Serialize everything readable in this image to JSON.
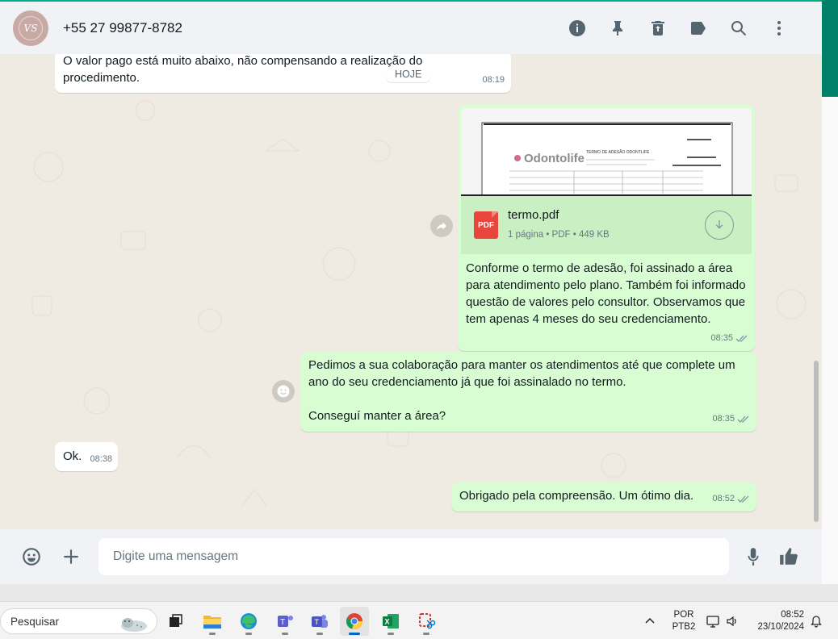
{
  "header": {
    "avatar_initials": "VS",
    "contact_name": "+55 27 99877-8782",
    "icons": [
      "info-icon",
      "pin-icon",
      "delete-icon",
      "label-icon",
      "search-icon",
      "menu-icon"
    ]
  },
  "chat": {
    "date_separator": "HOJE",
    "messages": [
      {
        "direction": "in",
        "text_line1": "O valor pago está muito abaixo, não compensando a realização do",
        "text_line2": "procedimento.",
        "time": "08:19"
      },
      {
        "direction": "out",
        "attachment": {
          "file_name": "termo.pdf",
          "file_type_badge": "PDF",
          "file_meta": "1 página • PDF • 449 KB",
          "thumb_brand": "Odontolife",
          "thumb_heading": "TERMO DE ADESÃO ODONTLIFE"
        },
        "text": "Conforme o termo de adesão, foi assinado a área para atendimento pelo plano. Também foi informado questão de valores pelo consultor. Observamos que tem apenas 4 meses do seu credenciamento.",
        "time": "08:35"
      },
      {
        "direction": "out",
        "text_para1": "Pedimos a sua colaboração para manter os atendimentos até que complete um ano do seu credenciamento já que foi assinalado no termo.",
        "text_para2": "Conseguí manter a área?",
        "time": "08:35"
      },
      {
        "direction": "in",
        "text": "Ok.",
        "time": "08:38"
      },
      {
        "direction": "out",
        "text": "Obrigado pela compreensão. Um ótimo dia.",
        "time": "08:52"
      }
    ]
  },
  "composer": {
    "placeholder": "Digite uma mensagem"
  },
  "taskbar": {
    "search_label": "Pesquisar",
    "lang_line1": "POR",
    "lang_line2": "PTB2",
    "clock_time": "08:52",
    "clock_date": "23/10/2024",
    "apps": [
      "task-view-icon",
      "file-explorer-icon",
      "edge-icon",
      "teams-icon",
      "teams-work-icon",
      "chrome-icon",
      "excel-icon",
      "snipping-tool-icon"
    ]
  },
  "colors": {
    "accent": "#00a884",
    "outgoing_bubble": "#d9fdd3",
    "incoming_bubble": "#ffffff",
    "chat_background": "#efeae2",
    "pdf_red": "#e8453c"
  }
}
